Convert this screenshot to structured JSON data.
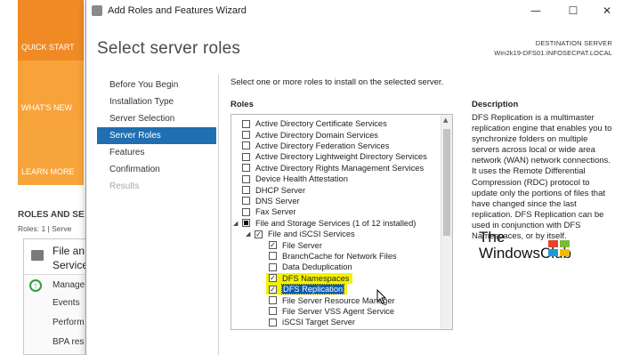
{
  "background": {
    "tiles": [
      {
        "label": "QUICK START"
      },
      {
        "label": "WHAT'S NEW"
      },
      {
        "label": "LEARN MORE"
      }
    ],
    "roles_header": "ROLES AND SE",
    "roles_sub": "Roles: 1  |  Serve",
    "card": {
      "title_line1": "File an",
      "title_line2": "Service",
      "items": [
        "Manage",
        "Events",
        "Perform",
        "BPA res"
      ]
    }
  },
  "window": {
    "title": "Add Roles and Features Wizard",
    "minimize": "—",
    "maximize": "☐",
    "close": "✕"
  },
  "header": {
    "title": "Select server roles",
    "destination_label": "DESTINATION SERVER",
    "destination_value": "Win2k19-DFS01.INFOSECPAT.LOCAL"
  },
  "nav": [
    {
      "label": "Before You Begin",
      "state": "normal"
    },
    {
      "label": "Installation Type",
      "state": "normal"
    },
    {
      "label": "Server Selection",
      "state": "normal"
    },
    {
      "label": "Server Roles",
      "state": "active"
    },
    {
      "label": "Features",
      "state": "normal"
    },
    {
      "label": "Confirmation",
      "state": "normal"
    },
    {
      "label": "Results",
      "state": "disabled"
    }
  ],
  "content": {
    "instruction": "Select one or more roles to install on the selected server.",
    "roles_label": "Roles",
    "roles": [
      {
        "label": "Active Directory Certificate Services",
        "checked": "none",
        "level": 0
      },
      {
        "label": "Active Directory Domain Services",
        "checked": "none",
        "level": 0
      },
      {
        "label": "Active Directory Federation Services",
        "checked": "none",
        "level": 0
      },
      {
        "label": "Active Directory Lightweight Directory Services",
        "checked": "none",
        "level": 0
      },
      {
        "label": "Active Directory Rights Management Services",
        "checked": "none",
        "level": 0
      },
      {
        "label": "Device Health Attestation",
        "checked": "none",
        "level": 0
      },
      {
        "label": "DHCP Server",
        "checked": "none",
        "level": 0
      },
      {
        "label": "DNS Server",
        "checked": "none",
        "level": 0
      },
      {
        "label": "Fax Server",
        "checked": "none",
        "level": 0
      },
      {
        "label": "File and Storage Services (1 of 12 installed)",
        "checked": "partial",
        "level": 0,
        "expander": "◢"
      },
      {
        "label": "File and iSCSI Services",
        "checked": "checked",
        "level": 1,
        "expander": "◢"
      },
      {
        "label": "File Server",
        "checked": "checked",
        "level": 2
      },
      {
        "label": "BranchCache for Network Files",
        "checked": "none",
        "level": 2
      },
      {
        "label": "Data Deduplication",
        "checked": "none",
        "level": 2
      },
      {
        "label": "DFS Namespaces",
        "checked": "checked",
        "level": 2,
        "highlight": true
      },
      {
        "label": "DFS Replication",
        "checked": "checked",
        "level": 2,
        "highlight": true,
        "selected": true
      },
      {
        "label": "File Server Resource Manager",
        "checked": "none",
        "level": 2
      },
      {
        "label": "File Server VSS Agent Service",
        "checked": "none",
        "level": 2
      },
      {
        "label": "iSCSI Target Server",
        "checked": "none",
        "level": 2
      }
    ],
    "description_label": "Description",
    "description": "DFS Replication is a multimaster replication engine that enables you to synchronize folders on multiple servers across local or wide area network (WAN) network connections. It uses the Remote Differential Compression (RDC) protocol to update only the portions of files that have changed since the last replication. DFS Replication can be used in conjunction with DFS Namespaces, or by itself.",
    "check_glyph": "✓"
  },
  "watermark": {
    "line1": "The",
    "line2": "WindowsClub"
  }
}
